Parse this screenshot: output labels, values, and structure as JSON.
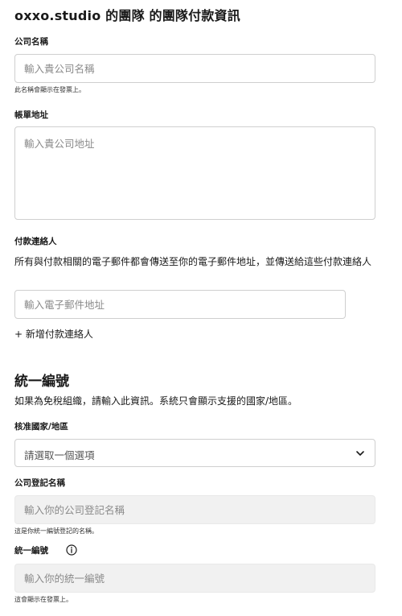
{
  "header": {
    "title": "oxxo.studio 的團隊 的團隊付款資訊"
  },
  "company_name": {
    "label": "公司名稱",
    "placeholder": "輸入貴公司名稱",
    "hint": "此名稱會顯示在發票上。"
  },
  "billing_address": {
    "label": "帳單地址",
    "placeholder": "輸入貴公司地址"
  },
  "billing_contact": {
    "label": "付款連絡人",
    "description": "所有與付款相關的電子郵件都會傳送至你的電子郵件地址，並傳送給這些付款連絡人",
    "placeholder": "輸入電子郵件地址",
    "add_link": "+ 新增付款連絡人"
  },
  "tax_id_section": {
    "title": "統一編號",
    "description": "如果為免稅組織，請輸入此資訊。系統只會顯示支援的國家/地區。",
    "country": {
      "label": "核准國家/地區",
      "selected": "請選取一個選項"
    },
    "registered_name": {
      "label": "公司登記名稱",
      "placeholder": "輸入你的公司登記名稱",
      "hint": "這是你統一編號登記的名稱。"
    },
    "tax_id": {
      "label": "統一編號",
      "placeholder": "輸入你的統一編號",
      "hint": "這會顯示在發票上。",
      "icon": "info-icon"
    }
  }
}
